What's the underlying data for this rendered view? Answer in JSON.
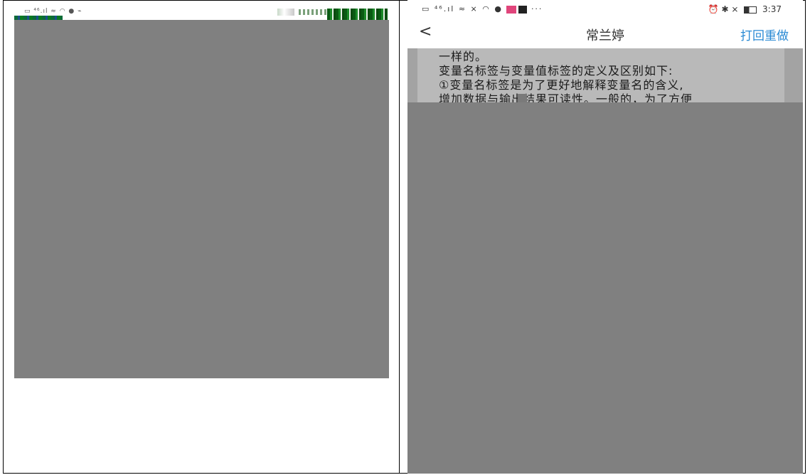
{
  "left_screenshot": {
    "status_icons": "▭ ⁴⁶.ıl ≈ ◠ ● ⌁"
  },
  "right_screenshot": {
    "status_bar": {
      "left_icons": "▭ ⁴⁶.ıl ≈ ⨯ ◠ ●",
      "more": "···",
      "right_icons": "⏰ ✱ ⨯",
      "time": "3:37"
    },
    "nav": {
      "back": "<",
      "title": "常兰婷",
      "action": "打回重做"
    },
    "content_lines": [
      "一样的。",
      "变量名标签与变量值标签的定义及区别如下:",
      "①变量名标签是为了更好地解释变量名的含义,",
      "增加数据与输出结果可读性。一般的，为了方便"
    ]
  }
}
